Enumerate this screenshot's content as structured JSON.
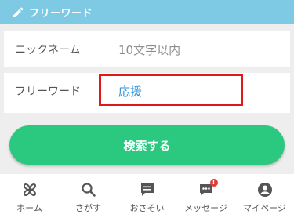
{
  "header": {
    "title": "フリーワード",
    "icon": "pencil-icon"
  },
  "form": {
    "nickname": {
      "label": "ニックネーム",
      "placeholder": "10文字以内"
    },
    "freeword": {
      "label": "フリーワード",
      "value": "応援"
    }
  },
  "search_button": {
    "label": "検索する"
  },
  "tabs": [
    {
      "label": "ホーム",
      "icon": "home-clover-icon"
    },
    {
      "label": "さがす",
      "icon": "search-icon"
    },
    {
      "label": "おさそい",
      "icon": "invite-chat-icon"
    },
    {
      "label": "メッセージ",
      "icon": "message-icon",
      "badge": "!"
    },
    {
      "label": "マイページ",
      "icon": "user-icon"
    }
  ],
  "colors": {
    "header": "#7ecae4",
    "button": "#2bc880",
    "highlight": "#e11818",
    "value_text": "#2b8fd6"
  }
}
